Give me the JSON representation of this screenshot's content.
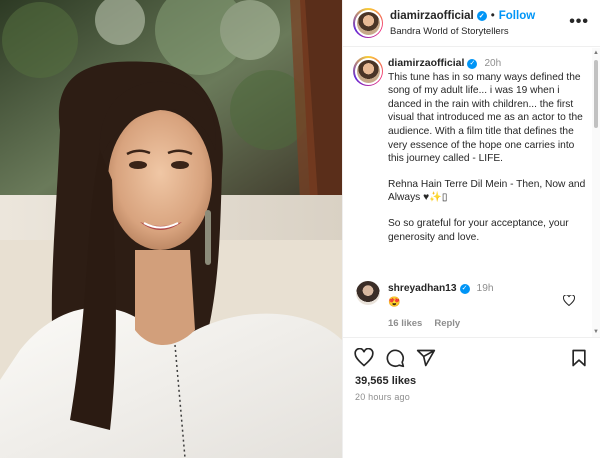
{
  "post": {
    "username": "diamirzaofficial",
    "follow_label": "Follow",
    "separator": "•",
    "location": "Bandra World of Storytellers",
    "more_icon": "more-horizontal-icon"
  },
  "caption": {
    "username": "diamirzaofficial",
    "time": "20h",
    "paragraph_1": "This tune has in so many ways defined the song of my adult life... i was 19 when i danced in the rain with children... the first visual that introduced me as an actor to the audience. With a film title that defines the very essence of the hope one carries into this journey called - LIFE.",
    "paragraph_2": "Rehna Hain Terre Dil Mein - Then, Now and Always ♥✨▯",
    "paragraph_3": "So so grateful for your acceptance, your generosity and love."
  },
  "comment": {
    "username": "shreyadhan13",
    "time": "19h",
    "text": "😍",
    "likes": "16 likes",
    "reply_label": "Reply"
  },
  "actions": {
    "likes_count": "39,565 likes",
    "time_ago": "20 hours ago"
  },
  "colors": {
    "accent": "#0095f6",
    "muted": "#8e8e8e",
    "text": "#262626"
  }
}
